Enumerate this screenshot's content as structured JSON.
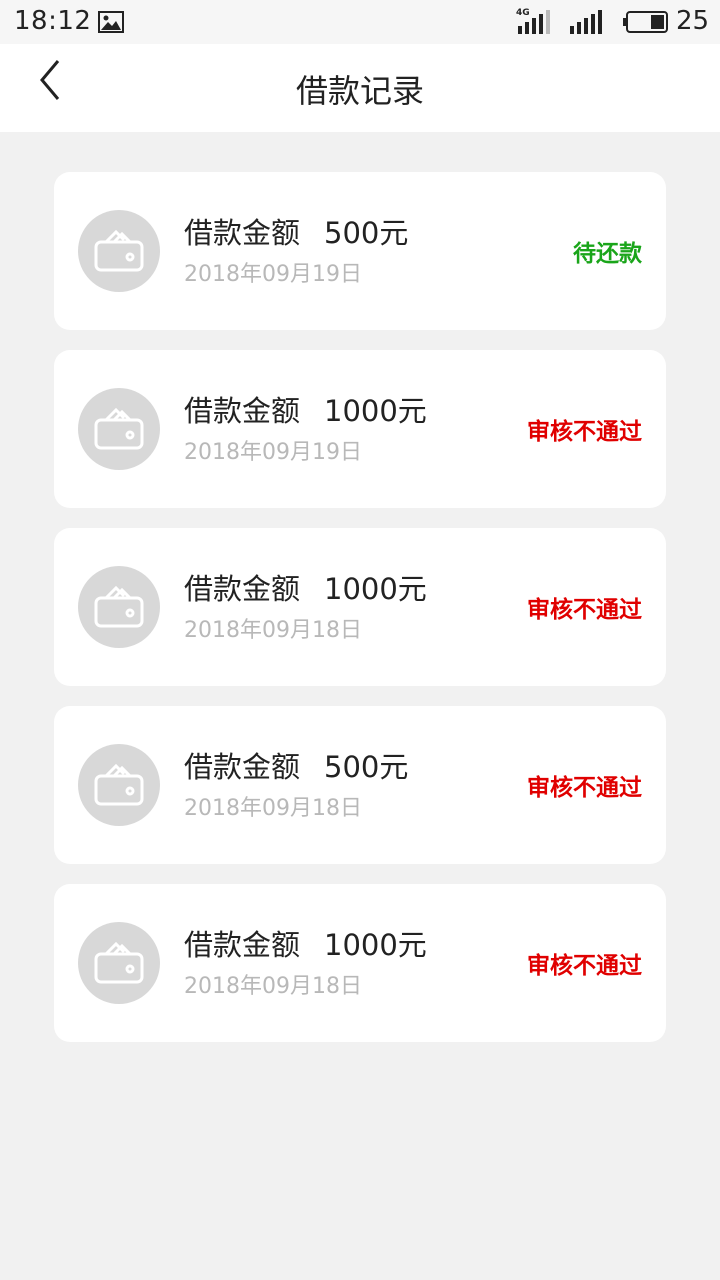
{
  "status_bar": {
    "time": "18:12",
    "network": "4G",
    "battery": "25"
  },
  "header": {
    "title": "借款记录"
  },
  "colors": {
    "pending": "#1aa51a",
    "rejected": "#e00000"
  },
  "records": [
    {
      "label": "借款金额",
      "amount": "500元",
      "date": "2018年09月19日",
      "status": "待还款",
      "status_type": "pending"
    },
    {
      "label": "借款金额",
      "amount": "1000元",
      "date": "2018年09月19日",
      "status": "审核不通过",
      "status_type": "rejected"
    },
    {
      "label": "借款金额",
      "amount": "1000元",
      "date": "2018年09月18日",
      "status": "审核不通过",
      "status_type": "rejected"
    },
    {
      "label": "借款金额",
      "amount": "500元",
      "date": "2018年09月18日",
      "status": "审核不通过",
      "status_type": "rejected"
    },
    {
      "label": "借款金额",
      "amount": "1000元",
      "date": "2018年09月18日",
      "status": "审核不通过",
      "status_type": "rejected"
    }
  ]
}
